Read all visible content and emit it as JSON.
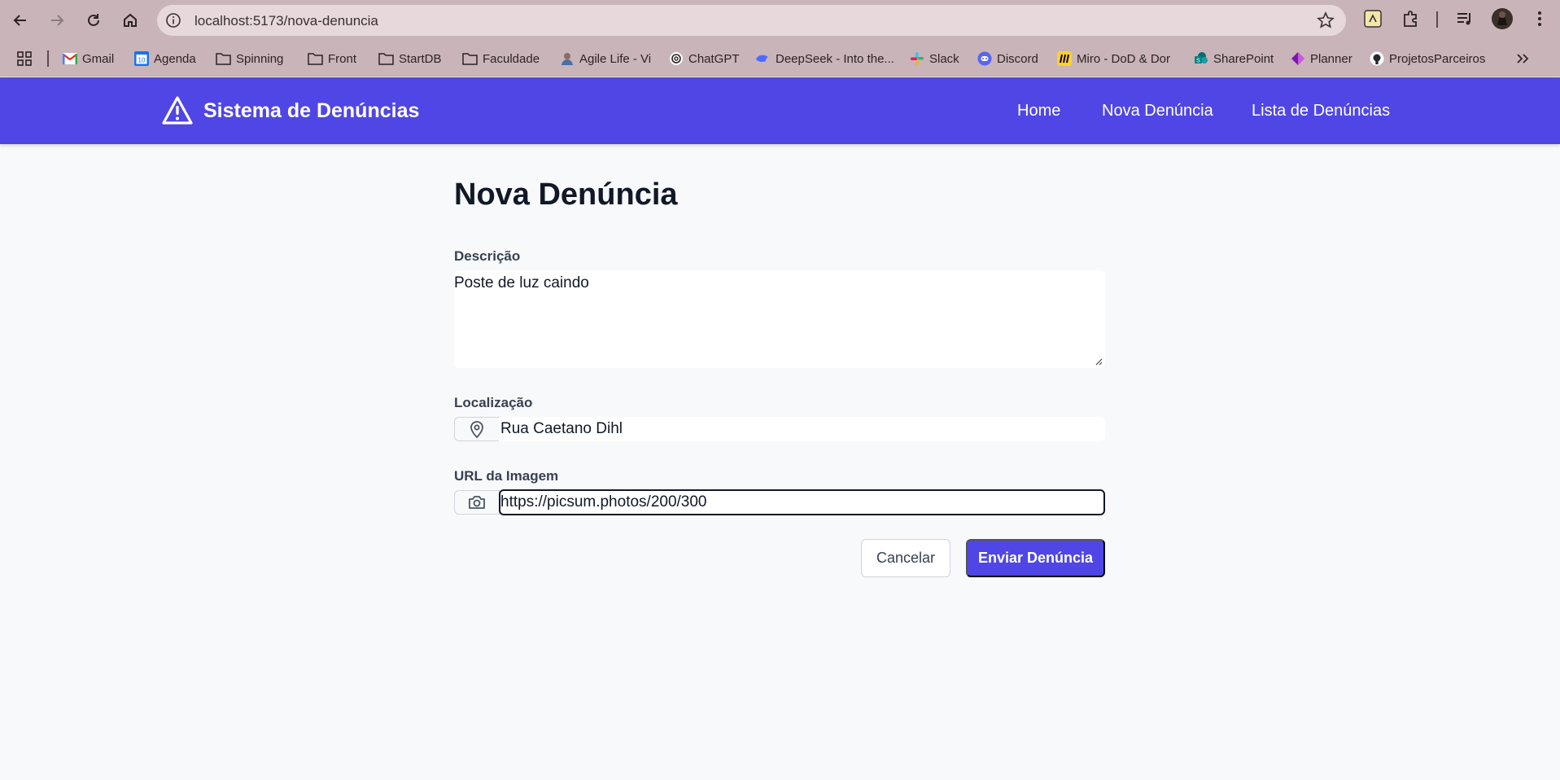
{
  "browser": {
    "url": "localhost:5173/nova-denuncia",
    "bookmarks": [
      {
        "label": "Gmail",
        "icon": "gmail-icon"
      },
      {
        "label": "Agenda",
        "icon": "calendar-icon"
      },
      {
        "label": "Spinning",
        "icon": "folder-icon"
      },
      {
        "label": "Front",
        "icon": "folder-icon"
      },
      {
        "label": "StartDB",
        "icon": "folder-icon"
      },
      {
        "label": "Faculdade",
        "icon": "folder-icon"
      },
      {
        "label": "Agile Life - Vi",
        "icon": "avatar-icon"
      },
      {
        "label": "ChatGPT",
        "icon": "chatgpt-icon"
      },
      {
        "label": "DeepSeek - Into the...",
        "icon": "deepseek-icon"
      },
      {
        "label": "Slack",
        "icon": "slack-icon"
      },
      {
        "label": "Discord",
        "icon": "discord-icon"
      },
      {
        "label": "Miro - DoD & Dor",
        "icon": "miro-icon"
      },
      {
        "label": "SharePoint",
        "icon": "sharepoint-icon"
      },
      {
        "label": "Planner",
        "icon": "planner-icon"
      },
      {
        "label": "ProjetosParceiros",
        "icon": "github-icon"
      }
    ]
  },
  "header": {
    "brand": "Sistema de Denúncias",
    "nav": {
      "home": "Home",
      "nova": "Nova Denúncia",
      "lista": "Lista de Denúncias"
    }
  },
  "form": {
    "title": "Nova Denúncia",
    "descricao_label": "Descrição",
    "descricao_value": "Poste de luz caindo",
    "localizacao_label": "Localização",
    "localizacao_value": "Rua Caetano Dihl",
    "imagem_label": "URL da Imagem",
    "imagem_value": "https://picsum.photos/200/300",
    "cancel_label": "Cancelar",
    "submit_label": "Enviar Denúncia"
  },
  "colors": {
    "primary": "#4f46e5",
    "chrome": "#c9b4b9",
    "background": "#f8f9fb"
  }
}
